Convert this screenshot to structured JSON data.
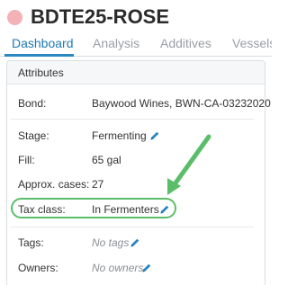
{
  "header": {
    "status_color": "#f4b1b6",
    "title": "BDTE25-ROSE"
  },
  "tabs": [
    {
      "label": "Dashboard",
      "active": true
    },
    {
      "label": "Analysis",
      "active": false
    },
    {
      "label": "Additives",
      "active": false
    },
    {
      "label": "Vessels",
      "active": false
    }
  ],
  "attributes": {
    "title": "Attributes",
    "bond": {
      "label": "Bond:",
      "value": "Baywood Wines, BWN-CA-03232020"
    },
    "stage": {
      "label": "Stage:",
      "value": "Fermenting"
    },
    "fill": {
      "label": "Fill:",
      "value": "65 gal"
    },
    "approx_cases": {
      "label": "Approx. cases:",
      "value": "27"
    },
    "tax_class": {
      "label": "Tax class:",
      "value": "In Fermenters"
    },
    "tags": {
      "label": "Tags:",
      "value": "No tags"
    },
    "owners": {
      "label": "Owners:",
      "value": "No owners"
    }
  },
  "colors": {
    "accent": "#2a87c2",
    "highlight": "#5bbd6a"
  },
  "icons": {
    "edit": "pencil-icon",
    "annotation": "arrow-icon"
  }
}
